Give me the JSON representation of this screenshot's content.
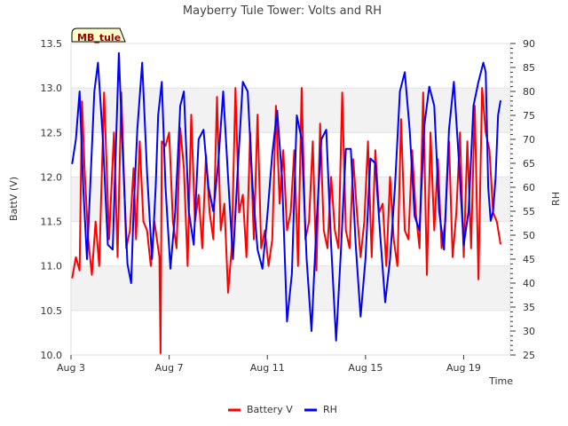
{
  "chart_data": {
    "type": "line",
    "title": "Mayberry Tule Tower: Volts and RH",
    "xlabel": "Time",
    "ylabel": "BattV (V)",
    "y2label": "RH",
    "station_badge": "MB_tule",
    "x_range_days": [
      3,
      20.9
    ],
    "x_ticks": [
      {
        "day": 3,
        "label": "Aug 3"
      },
      {
        "day": 7,
        "label": "Aug 7"
      },
      {
        "day": 11,
        "label": "Aug 11"
      },
      {
        "day": 15,
        "label": "Aug 15"
      },
      {
        "day": 19,
        "label": "Aug 19"
      }
    ],
    "ylim": [
      10.0,
      13.5
    ],
    "y_ticks": [
      "10.0",
      "10.5",
      "11.0",
      "11.5",
      "12.0",
      "12.5",
      "13.0",
      "13.5"
    ],
    "y2lim": [
      25,
      90
    ],
    "y2_ticks": [
      "25",
      "30",
      "35",
      "40",
      "45",
      "50",
      "55",
      "60",
      "65",
      "70",
      "75",
      "80",
      "85",
      "90"
    ],
    "bands": [
      [
        10.5,
        11.0
      ],
      [
        11.5,
        12.0
      ],
      [
        12.5,
        13.0
      ]
    ],
    "grid": true,
    "legend_position": "bottom",
    "series": [
      {
        "name": "Battery V",
        "axis": "left",
        "color": "#ff0000",
        "x": [
          3.05,
          3.2,
          3.35,
          3.45,
          3.55,
          3.7,
          3.85,
          4.0,
          4.15,
          4.35,
          4.55,
          4.75,
          4.9,
          5.05,
          5.25,
          5.4,
          5.55,
          5.65,
          5.8,
          5.95,
          6.1,
          6.25,
          6.4,
          6.5,
          6.6,
          6.65,
          6.7,
          6.85,
          7.0,
          7.15,
          7.3,
          7.45,
          7.6,
          7.75,
          7.9,
          8.05,
          8.2,
          8.35,
          8.5,
          8.65,
          8.8,
          8.95,
          9.1,
          9.25,
          9.4,
          9.55,
          9.7,
          9.85,
          10.0,
          10.15,
          10.3,
          10.45,
          10.6,
          10.75,
          10.9,
          11.05,
          11.2,
          11.35,
          11.5,
          11.65,
          11.8,
          11.95,
          12.1,
          12.25,
          12.4,
          12.55,
          12.7,
          12.85,
          13.0,
          13.15,
          13.3,
          13.45,
          13.6,
          13.75,
          13.9,
          14.05,
          14.2,
          14.35,
          14.5,
          14.65,
          14.8,
          14.95,
          15.1,
          15.25,
          15.4,
          15.55,
          15.7,
          15.85,
          16.0,
          16.15,
          16.3,
          16.45,
          16.6,
          16.75,
          16.9,
          17.05,
          17.2,
          17.35,
          17.5,
          17.65,
          17.8,
          17.95,
          18.1,
          18.25,
          18.4,
          18.55,
          18.7,
          18.85,
          19.0,
          19.15,
          19.3,
          19.45,
          19.6,
          19.75,
          19.9,
          20.05,
          20.2,
          20.35,
          20.5
        ],
        "values": [
          10.87,
          11.1,
          10.95,
          12.85,
          12.1,
          11.3,
          10.9,
          11.5,
          11.0,
          12.95,
          11.3,
          12.5,
          11.1,
          12.95,
          11.2,
          11.4,
          12.1,
          11.3,
          12.4,
          11.5,
          11.4,
          11.0,
          11.5,
          11.3,
          11.1,
          10.02,
          12.4,
          12.35,
          12.5,
          11.5,
          11.2,
          12.55,
          12.1,
          11.0,
          12.7,
          11.5,
          11.8,
          11.2,
          12.25,
          11.6,
          11.3,
          12.9,
          11.4,
          11.7,
          10.7,
          11.2,
          13.0,
          11.6,
          11.8,
          11.1,
          12.5,
          11.3,
          12.7,
          11.2,
          11.4,
          11.0,
          11.3,
          12.8,
          11.7,
          12.3,
          11.4,
          11.6,
          12.3,
          11.0,
          13.0,
          11.3,
          11.5,
          12.4,
          10.95,
          12.6,
          11.4,
          11.2,
          12.0,
          11.4,
          11.2,
          12.95,
          11.4,
          11.2,
          12.2,
          11.6,
          11.1,
          11.5,
          12.4,
          11.1,
          12.3,
          11.6,
          11.7,
          11.0,
          12.0,
          11.3,
          11.0,
          12.65,
          11.4,
          11.3,
          12.3,
          11.6,
          11.2,
          12.95,
          10.9,
          12.5,
          11.4,
          12.2,
          11.2,
          11.5,
          12.4,
          11.1,
          11.6,
          12.5,
          11.1,
          12.4,
          11.2,
          12.8,
          10.85,
          13.0,
          12.5,
          12.3,
          11.6,
          11.5,
          11.25
        ]
      },
      {
        "name": "RH",
        "axis": "right",
        "color": "#0000ff",
        "x": [
          3.05,
          3.2,
          3.35,
          3.5,
          3.65,
          3.8,
          3.95,
          4.1,
          4.3,
          4.5,
          4.7,
          4.85,
          4.95,
          5.1,
          5.3,
          5.45,
          5.55,
          5.7,
          5.9,
          6.1,
          6.3,
          6.45,
          6.55,
          6.7,
          6.85,
          7.05,
          7.25,
          7.45,
          7.6,
          7.8,
          8.0,
          8.2,
          8.4,
          8.6,
          8.8,
          9.0,
          9.2,
          9.4,
          9.6,
          9.8,
          10.0,
          10.2,
          10.4,
          10.6,
          10.8,
          11.0,
          11.2,
          11.4,
          11.6,
          11.8,
          12.0,
          12.2,
          12.4,
          12.6,
          12.8,
          13.0,
          13.2,
          13.4,
          13.6,
          13.8,
          14.0,
          14.2,
          14.4,
          14.6,
          14.8,
          15.0,
          15.2,
          15.4,
          15.6,
          15.8,
          16.0,
          16.2,
          16.4,
          16.6,
          16.8,
          17.0,
          17.2,
          17.4,
          17.6,
          17.8,
          18.0,
          18.2,
          18.4,
          18.6,
          18.8,
          19.0,
          19.2,
          19.4,
          19.6,
          19.8,
          19.9,
          20.0,
          20.1,
          20.2,
          20.3,
          20.4,
          20.5
        ],
        "values": [
          65,
          70,
          80,
          60,
          45,
          62,
          80,
          86,
          70,
          48,
          47,
          72,
          88,
          68,
          44,
          40,
          55,
          72,
          86,
          63,
          45,
          60,
          75,
          82,
          60,
          43,
          55,
          77,
          80,
          55,
          48,
          70,
          72,
          60,
          55,
          65,
          80,
          62,
          45,
          64,
          82,
          80,
          60,
          47,
          43,
          54,
          67,
          76,
          62,
          32,
          42,
          75,
          70,
          45,
          30,
          52,
          70,
          72,
          48,
          28,
          47,
          68,
          68,
          48,
          33,
          45,
          66,
          65,
          50,
          36,
          45,
          60,
          80,
          84,
          72,
          54,
          51,
          73,
          81,
          77,
          55,
          47,
          72,
          82,
          66,
          48,
          55,
          77,
          82,
          86,
          84,
          60,
          53,
          55,
          62,
          75,
          78
        ]
      }
    ]
  }
}
